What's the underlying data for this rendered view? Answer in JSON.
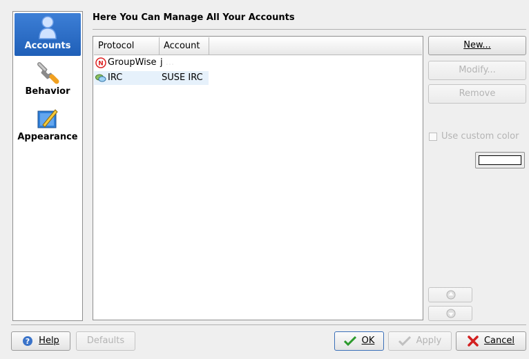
{
  "sidebar": {
    "items": [
      {
        "label": "Accounts",
        "icon": "user-icon",
        "active": true
      },
      {
        "label": "Behavior",
        "icon": "wrench-icon",
        "active": false
      },
      {
        "label": "Appearance",
        "icon": "paint-icon",
        "active": false
      }
    ]
  },
  "header": {
    "title": "Here You Can Manage All Your Accounts"
  },
  "table": {
    "columns": [
      "Protocol",
      "Account"
    ],
    "rows": [
      {
        "protocol": "GroupWise",
        "account": "j",
        "account_faded": "...",
        "icon": "groupwise-icon"
      },
      {
        "protocol": "IRC",
        "account": "SUSE IRC",
        "icon": "irc-icon"
      }
    ]
  },
  "actions": {
    "new_label": "New...",
    "modify_label": "Modify...",
    "remove_label": "Remove",
    "custom_color_label": "Use custom color"
  },
  "footer": {
    "help_label": "Help",
    "defaults_label": "Defaults",
    "ok_label": "OK",
    "apply_label": "Apply",
    "cancel_label": "Cancel"
  },
  "colors": {
    "accent": "#2a6ccb",
    "selection": "#e6f1fb"
  }
}
